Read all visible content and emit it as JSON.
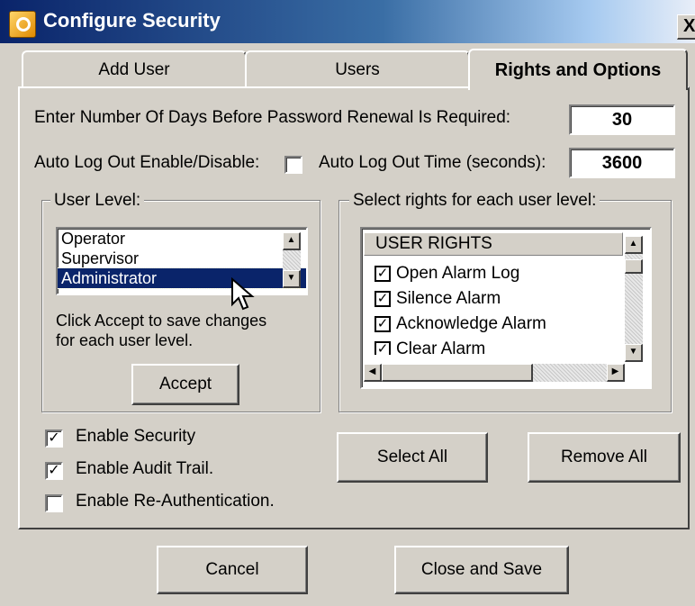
{
  "window": {
    "title": "Configure Security",
    "close_glyph": "X"
  },
  "tabs": [
    {
      "label": "Add User",
      "active": false
    },
    {
      "label": "Users",
      "active": false
    },
    {
      "label": "Rights and Options",
      "active": true
    }
  ],
  "password": {
    "label": "Enter Number Of Days Before Password Renewal Is Required:",
    "value": "30"
  },
  "auto_logout": {
    "enable_label": "Auto Log Out Enable/Disable:",
    "enabled": false,
    "time_label": "Auto Log Out Time (seconds):",
    "time_value": "3600"
  },
  "user_level": {
    "title": "User Level:",
    "items": [
      "Operator",
      "Supervisor",
      "Administrator"
    ],
    "selected": "Administrator",
    "hint": [
      "Click Accept to save changes",
      "for each user level."
    ],
    "accept_label": "Accept"
  },
  "rights": {
    "title": "Select rights for each user level:",
    "header": "USER RIGHTS",
    "items": [
      {
        "label": "Open Alarm Log",
        "checked": true
      },
      {
        "label": "Silence Alarm",
        "checked": true
      },
      {
        "label": "Acknowledge Alarm",
        "checked": true
      },
      {
        "label": "Clear Alarm",
        "checked": true
      }
    ]
  },
  "options": [
    {
      "label": "Enable Security",
      "checked": true
    },
    {
      "label": "Enable Audit Trail.",
      "checked": true
    },
    {
      "label": "Enable Re-Authentication.",
      "checked": false
    }
  ],
  "buttons": {
    "select_all": "Select All",
    "remove_all": "Remove All",
    "cancel": "Cancel",
    "close_save": "Close and Save"
  },
  "colors": {
    "title_start": "#0a246a",
    "selection": "#0a246a",
    "face": "#d4d0c8"
  }
}
